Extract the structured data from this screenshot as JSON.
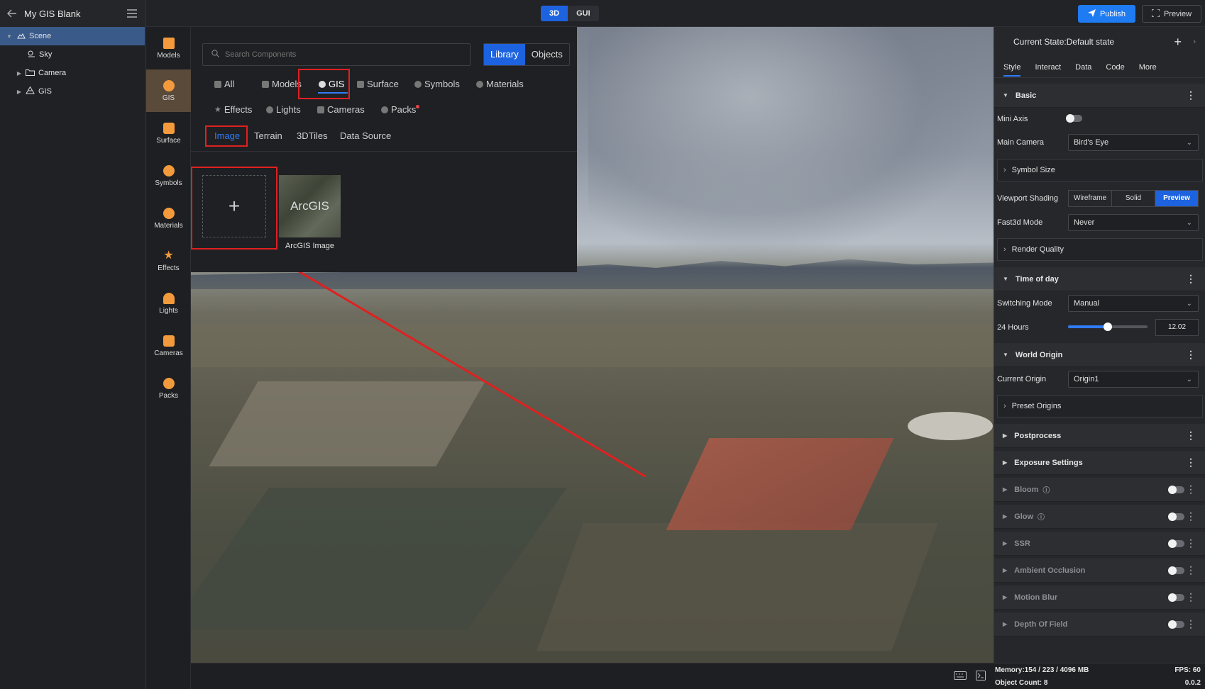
{
  "app": {
    "title": "My GIS Blank"
  },
  "topbar": {
    "mode_tabs": [
      "3D",
      "GUI"
    ],
    "active_mode": "3D",
    "publish_label": "Publish",
    "preview_label": "Preview",
    "accent_color": "#1d63e0"
  },
  "tree": {
    "items": [
      {
        "label": "Scene",
        "icon": "scene-icon",
        "selected": true
      },
      {
        "label": "Sky",
        "icon": "sky-icon"
      },
      {
        "label": "Camera",
        "icon": "folder-icon"
      },
      {
        "label": "GIS",
        "icon": "gis-icon"
      }
    ]
  },
  "rail": {
    "items": [
      "Models",
      "GIS",
      "Surface",
      "Symbols",
      "Materials",
      "Effects",
      "Lights",
      "Cameras",
      "Packs"
    ],
    "active": "GIS"
  },
  "library": {
    "search_placeholder": "Search Components",
    "toggle": [
      "Library",
      "Objects"
    ],
    "active_toggle": "Library",
    "categories": [
      "All",
      "Models",
      "GIS",
      "Surface",
      "Symbols",
      "Materials",
      "Effects",
      "Lights",
      "Cameras",
      "Packs"
    ],
    "active_category": "GIS",
    "subtabs": [
      "Image",
      "Terrain",
      "3DTiles",
      "Data Source"
    ],
    "active_subtab": "Image",
    "add_symbol": "+",
    "card": {
      "thumb_text": "ArcGIS",
      "label": "ArcGIS Image"
    }
  },
  "inspector": {
    "state": "Current State:Default state",
    "tabs": [
      "Style",
      "Interact",
      "Data",
      "Code",
      "More"
    ],
    "active_tab": "Style",
    "basic": {
      "title": "Basic",
      "mini_axis_label": "Mini Axis",
      "main_camera_label": "Main Camera",
      "main_camera_value": "Bird's Eye",
      "symbol_size": "Symbol Size",
      "viewport_shading_label": "Viewport Shading",
      "shading_options": [
        "Wireframe",
        "Solid",
        "Preview"
      ],
      "active_shading": "Preview",
      "fast3d_label": "Fast3d Mode",
      "fast3d_value": "Never",
      "render_quality": "Render Quality"
    },
    "time_of_day": {
      "title": "Time of day",
      "switching_label": "Switching Mode",
      "switching_value": "Manual",
      "hours_label": "24 Hours",
      "hours_value": "12.02",
      "hours_fraction": 0.5
    },
    "world_origin": {
      "title": "World Origin",
      "current_label": "Current Origin",
      "current_value": "Origin1",
      "preset": "Preset Origins"
    },
    "postprocess": {
      "title": "Postprocess"
    },
    "exposure": {
      "title": "Exposure Settings"
    },
    "effects": [
      "Bloom",
      "Glow",
      "SSR",
      "Ambient Occlusion",
      "Motion Blur",
      "Depth Of Field"
    ]
  },
  "status": {
    "memory": "Memory:154 / 223 / 4096 MB",
    "fps": "FPS: 60",
    "objects": "Object Count: 8",
    "version": "0.0.2"
  }
}
